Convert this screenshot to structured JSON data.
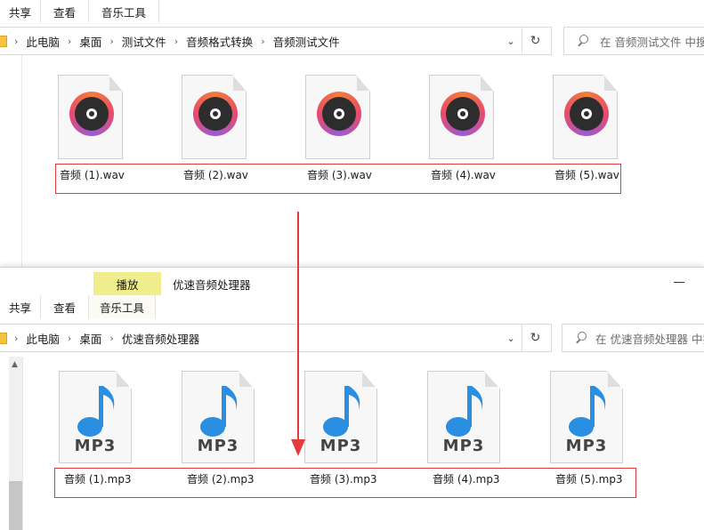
{
  "window_top": {
    "tabs": [
      "共享",
      "查看",
      "音乐工具"
    ],
    "breadcrumb": [
      "此电脑",
      "桌面",
      "测试文件",
      "音频格式转换",
      "音频测试文件"
    ],
    "search_placeholder": "在 音频测试文件 中搜",
    "files": [
      "音频 (1).wav",
      "音频 (2).wav",
      "音频 (3).wav",
      "音频 (4).wav",
      "音频 (5).wav"
    ]
  },
  "window_bottom": {
    "context_tab": "播放",
    "title": "优速音频处理器",
    "tabs": [
      "共享",
      "查看",
      "音乐工具"
    ],
    "breadcrumb": [
      "此电脑",
      "桌面",
      "优速音频处理器"
    ],
    "search_placeholder": "在 优速音频处理器 中搜",
    "files": [
      "音频 (1).mp3",
      "音频 (2).mp3",
      "音频 (3).mp3",
      "音频 (4).mp3",
      "音频 (5).mp3"
    ],
    "mp3_label": "MP3"
  },
  "colors": {
    "highlight": "#e23b3b",
    "context_tab": "#f0ee8c",
    "note_blue": "#2a8fe0"
  }
}
